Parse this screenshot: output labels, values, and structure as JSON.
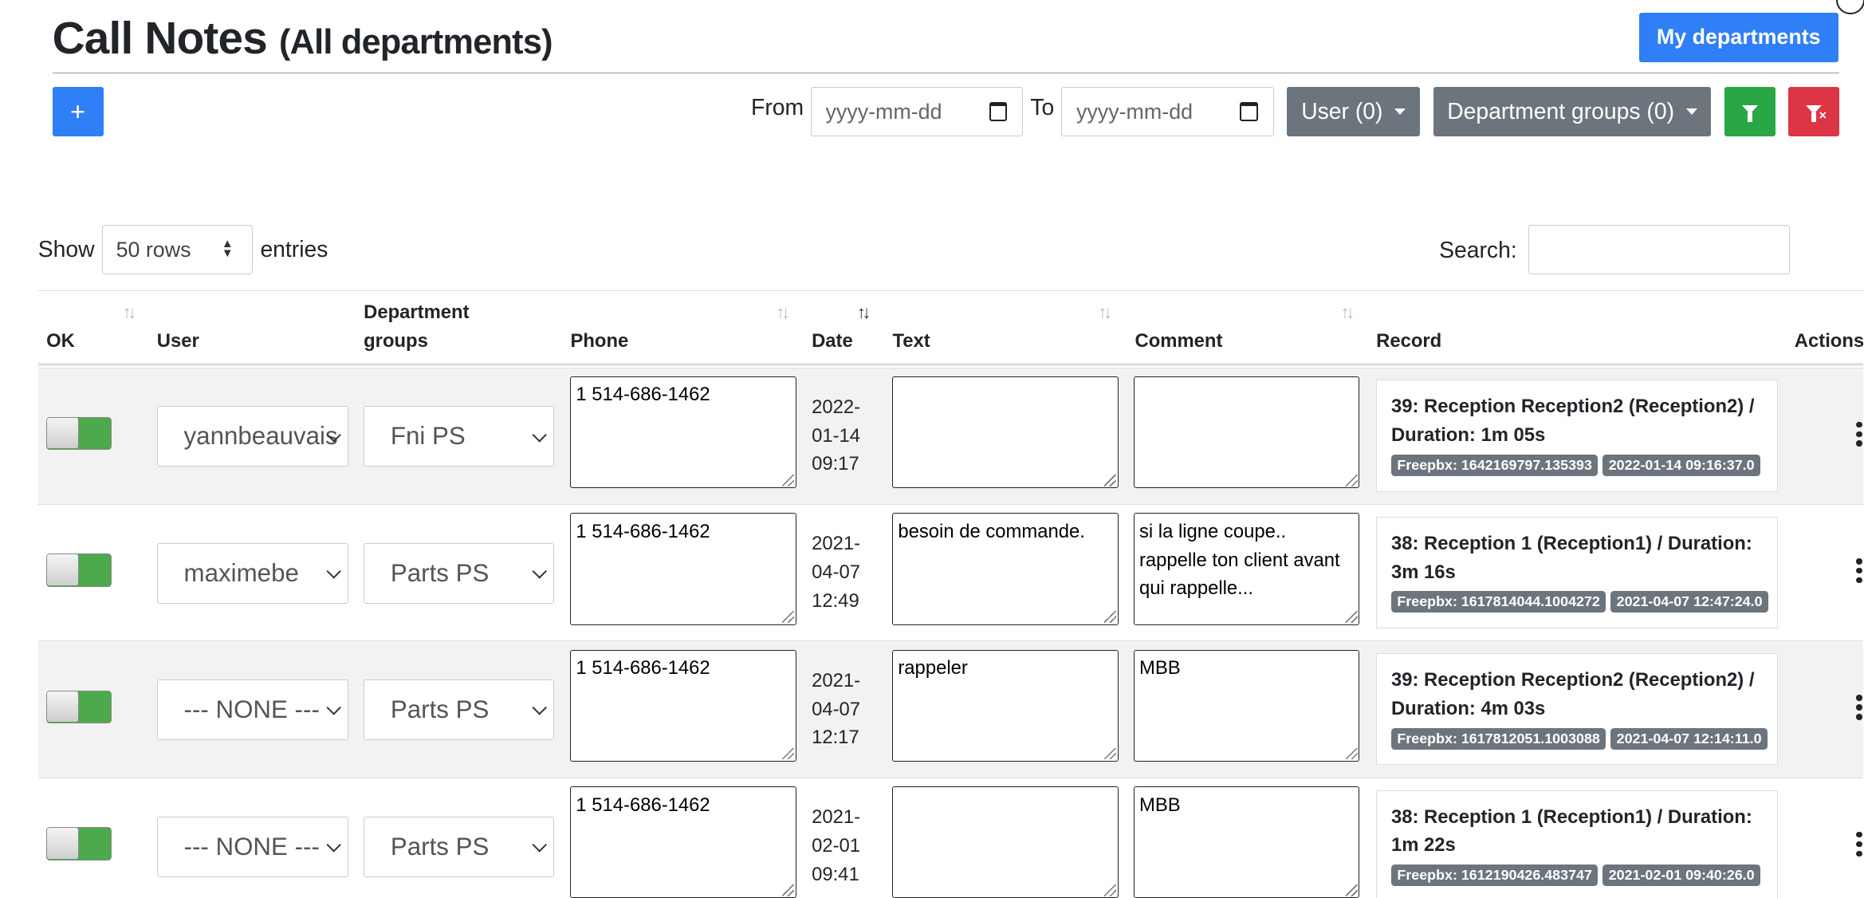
{
  "header": {
    "title": "Call Notes",
    "subtitle": "(All departments)",
    "my_departments": "My departments"
  },
  "toolbar": {
    "add_label": "+",
    "from_label": "From",
    "to_label": "To",
    "from_placeholder": "yyyy-mm-dd",
    "to_placeholder": "yyyy-mm-dd",
    "user_filter": "User (0)",
    "dept_filter": "Department groups (0)"
  },
  "table_controls": {
    "show_label": "Show",
    "rows_value": "50 rows",
    "entries_label": "entries",
    "search_label": "Search:"
  },
  "columns": {
    "ok": "OK",
    "user": "User",
    "dept1": "Department",
    "dept2": "groups",
    "phone": "Phone",
    "date": "Date",
    "text": "Text",
    "comment": "Comment",
    "record": "Record",
    "actions": "Actions"
  },
  "rows": [
    {
      "ok": true,
      "user": "yannbeauvais",
      "dept": "Fni PS",
      "phone": "1 514-686-1462",
      "date1": "2022-",
      "date2": "01-14",
      "date3": "09:17",
      "text": "",
      "comment": "",
      "record": "39: Reception Reception2 (Reception2) / Duration: 1m 05s",
      "freepbx": "Freepbx: 1642169797.135393",
      "rec_time": "2022-01-14 09:16:37.0"
    },
    {
      "ok": true,
      "user": "maximebe",
      "dept": "Parts PS",
      "phone": "1 514-686-1462",
      "date1": "2021-",
      "date2": "04-07",
      "date3": "12:49",
      "text": "besoin de commande.",
      "comment": "si la ligne coupe.. rappelle ton client avant qui rappelle...",
      "record": "38: Reception 1 (Reception1) / Duration: 3m 16s",
      "freepbx": "Freepbx: 1617814044.1004272",
      "rec_time": "2021-04-07 12:47:24.0"
    },
    {
      "ok": true,
      "user": "--- NONE ---",
      "dept": "Parts PS",
      "phone": "1 514-686-1462",
      "date1": "2021-",
      "date2": "04-07",
      "date3": "12:17",
      "text": "rappeler",
      "comment": "MBB",
      "record": "39: Reception Reception2 (Reception2) / Duration: 4m 03s",
      "freepbx": "Freepbx: 1617812051.1003088",
      "rec_time": "2021-04-07 12:14:11.0"
    },
    {
      "ok": true,
      "user": "--- NONE ---",
      "dept": "Parts PS",
      "phone": "1 514-686-1462",
      "date1": "2021-",
      "date2": "02-01",
      "date3": "09:41",
      "text": "",
      "comment": "MBB",
      "record": "38: Reception 1 (Reception1) / Duration: 1m 22s",
      "freepbx": "Freepbx: 1612190426.483747",
      "rec_time": "2021-02-01 09:40:26.0"
    }
  ],
  "colors": {
    "primary": "#2f7ff6",
    "secondary": "#6c757d",
    "success": "#29a745",
    "danger": "#dc3545"
  }
}
